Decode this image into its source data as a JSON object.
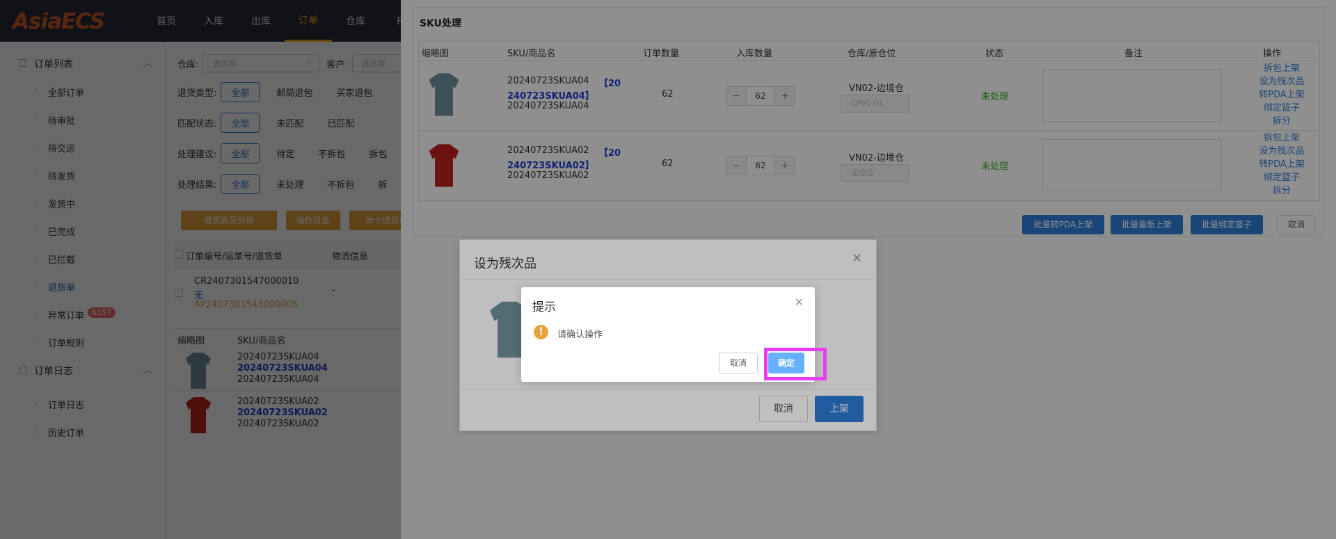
{
  "brand": {
    "logo_text": "AsiaECS"
  },
  "topnav": [
    "首页",
    "入库",
    "出库",
    "订单",
    "仓库",
    "FB"
  ],
  "sidebar": {
    "group1": "订单列表",
    "items": [
      "全部订单",
      "待审批",
      "待交运",
      "待发货",
      "发货中",
      "已完成",
      "已拦截",
      "退货单",
      "异常订单",
      "订单规则"
    ],
    "abnormal_badge": "6157",
    "group2": "订单日志",
    "log_items": [
      "订单日志",
      "历史订单"
    ]
  },
  "filters": {
    "warehouse_label": "仓库:",
    "warehouse_placeholder": "请选择",
    "customer_label": "客户:",
    "customer_placeholder": "请选择",
    "return_type_label": "退货类型:",
    "return_type_opts": [
      "全部",
      "邮局退包",
      "买家退包"
    ],
    "match_label": "匹配状态:",
    "match_opts": [
      "全部",
      "未匹配",
      "已匹配"
    ],
    "suggest_label": "处理建议:",
    "suggest_opts": [
      "全部",
      "待定",
      "不拆包",
      "拆包"
    ],
    "result_label": "处理结果:",
    "result_opts": [
      "全部",
      "未处理",
      "不拆包",
      "拆"
    ]
  },
  "actions": [
    "退货商品分析",
    "操作日志",
    "单个退货单上架"
  ],
  "list": {
    "col_order": "订单编号/运单号/退货单",
    "col_logistics": "物流信息",
    "order_no": "CR2407301547000010",
    "tracking": "无",
    "return_no": "AP2407301543000005",
    "logistics_val": "-",
    "sub_head_img": "缩略图",
    "sub_head_sku": "SKU/商品名",
    "items": [
      {
        "sku": "20240723SKUA04",
        "code": "20240723SKUA04",
        "name": "20240723SKUA04"
      },
      {
        "sku": "20240723SKUA02",
        "code": "20240723SKUA02",
        "name": "20240723SKUA02"
      }
    ]
  },
  "sku_panel": {
    "title": "SKU处理",
    "headers": [
      "缩略图",
      "SKU/商品名",
      "订单数量",
      "入库数量",
      "仓库/原仓位",
      "状态",
      "备注",
      "操作"
    ],
    "rows": [
      {
        "sku": "20240723SKUA04",
        "code_a": "【20",
        "code_b": "240723SKUA04】",
        "name": "20240723SKUA04",
        "order_qty": "62",
        "in_qty": "62",
        "warehouse": "VN02-边境仓",
        "location": "CP01-01",
        "status": "未处理",
        "color": "#6f8f9b"
      },
      {
        "sku": "20240723SKUA02",
        "code_a": "【20",
        "code_b": "240723SKUA02】",
        "name": "20240723SKUA02",
        "order_qty": "62",
        "in_qty": "62",
        "warehouse": "VN02-边境仓",
        "location": "无仓位",
        "status": "未处理",
        "color": "#c0231e"
      }
    ],
    "ops": [
      "拆包上架",
      "设为残次品",
      "转PDA上架",
      "绑定篮子",
      "拆分"
    ],
    "bulk": [
      "批量转PDA上架",
      "批量重新上架",
      "批量绑定篮子",
      "取消"
    ]
  },
  "defect_dialog": {
    "title": "设为残次品",
    "cancel": "取消",
    "confirm": "上架"
  },
  "confirm_dialog": {
    "title": "提示",
    "message": "请确认操作",
    "cancel": "取消",
    "ok": "确定"
  },
  "colors": {
    "accent": "#f5a623",
    "primary": "#2e7bd6",
    "success": "#2aa515",
    "warning": "#e6a23c",
    "highlight": "#e93cf5"
  }
}
